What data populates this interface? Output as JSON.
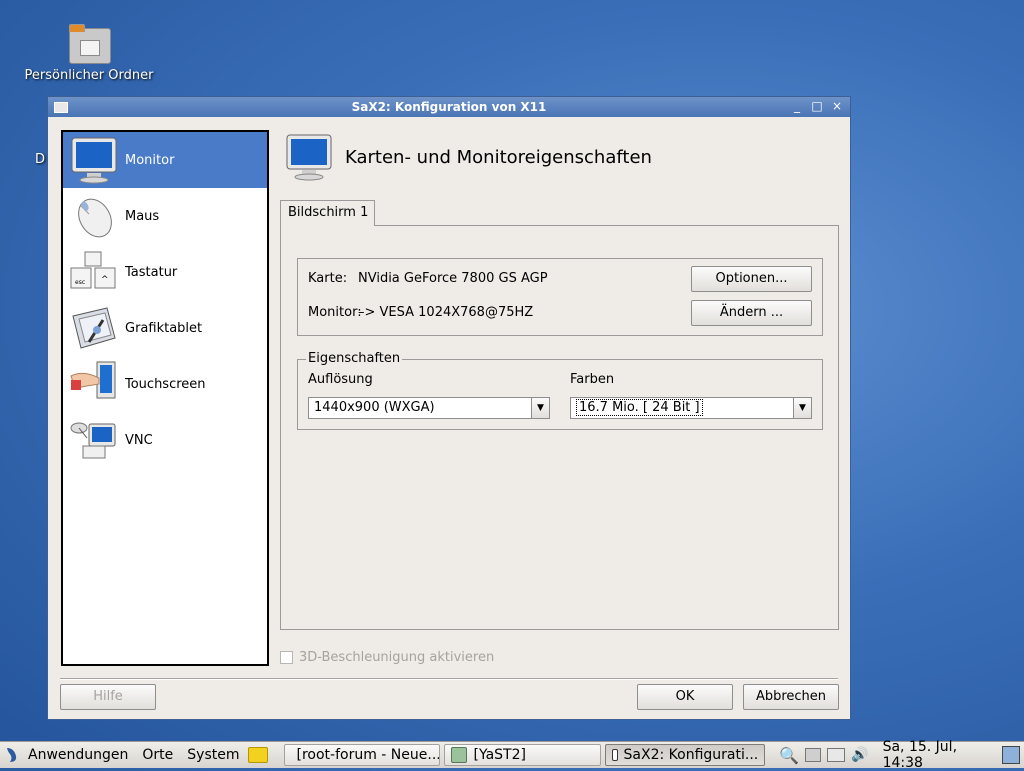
{
  "desktop": {
    "home_folder_label": "Persönlicher Ordner",
    "partial_label": "D"
  },
  "window": {
    "title": "SaX2: Konfiguration von X11",
    "controls": {
      "minimize": "_",
      "maximize": "□",
      "close": "×"
    }
  },
  "sidebar": {
    "items": [
      {
        "label": "Monitor",
        "icon": "monitor-icon",
        "selected": true
      },
      {
        "label": "Maus",
        "icon": "mouse-icon",
        "selected": false
      },
      {
        "label": "Tastatur",
        "icon": "keyboard-icon",
        "selected": false
      },
      {
        "label": "Grafiktablet",
        "icon": "tablet-icon",
        "selected": false
      },
      {
        "label": "Touchscreen",
        "icon": "touchscreen-icon",
        "selected": false
      },
      {
        "label": "VNC",
        "icon": "vnc-icon",
        "selected": false
      }
    ]
  },
  "main": {
    "title": "Karten- und Monitoreigenschaften",
    "tabs": [
      {
        "label": "Bildschirm 1"
      }
    ],
    "card_label": "Karte:",
    "card_value": "NVidia GeForce 7800 GS AGP",
    "monitor_label": "Monitor:",
    "monitor_value": "–> VESA 1024X768@75HZ",
    "options_button": "Optionen...",
    "change_button": "Ändern ...",
    "properties_legend": "Eigenschaften",
    "resolution_label": "Auflösung",
    "resolution_value": "1440x900 (WXGA)",
    "colors_label": "Farben",
    "colors_value": "16.7 Mio. [ 24 Bit ]",
    "accel_checkbox": "3D-Beschleunigung aktivieren"
  },
  "footer": {
    "help_button": "Hilfe",
    "ok_button": "OK",
    "cancel_button": "Abbrechen"
  },
  "taskbar": {
    "menu_applications": "Anwendungen",
    "menu_places": "Orte",
    "menu_system": "System",
    "tasks": [
      {
        "label": "[root-forum - Neue...",
        "icon": "firefox-icon"
      },
      {
        "label": "[YaST2]",
        "icon": "yast-icon"
      },
      {
        "label": "SaX2: Konfigurati...",
        "icon": "window-icon"
      }
    ],
    "clock": "Sa, 15. Jul, 14:38"
  }
}
